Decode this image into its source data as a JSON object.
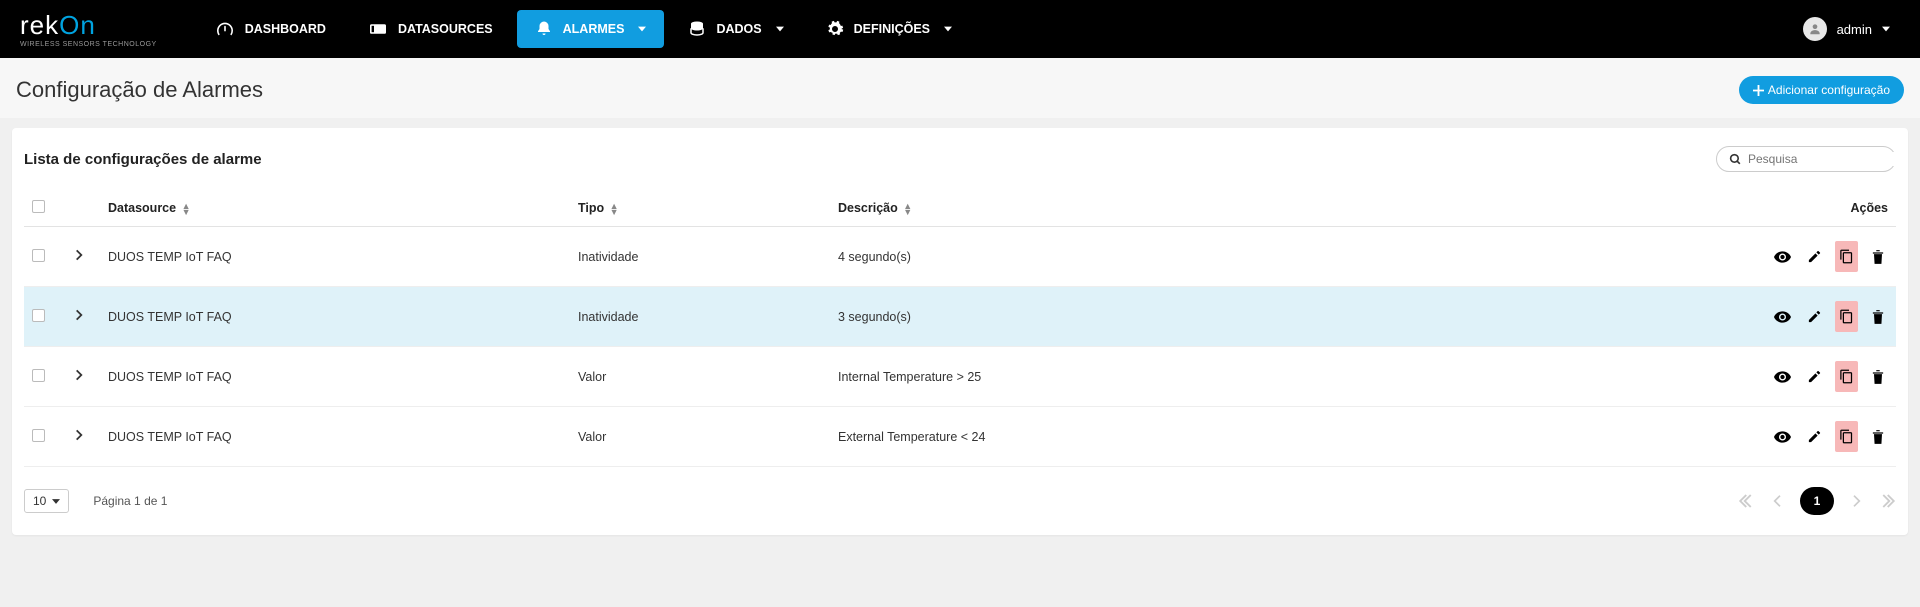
{
  "logo": {
    "part1": "rek",
    "part2": "On",
    "sub": "WIRELESS SENSORS TECHNOLOGY"
  },
  "nav": {
    "dashboard": "DASHBOARD",
    "datasources": "DATASOURCES",
    "alarmes": "ALARMES",
    "dados": "DADOS",
    "definicoes": "DEFINIÇÕES"
  },
  "user": {
    "name": "admin"
  },
  "page": {
    "title": "Configuração de Alarmes",
    "add_btn": "Adicionar configuração"
  },
  "list": {
    "title": "Lista de configurações de alarme",
    "search_placeholder": "Pesquisa",
    "headers": {
      "datasource": "Datasource",
      "tipo": "Tipo",
      "descricao": "Descrição",
      "acoes": "Ações"
    },
    "rows": [
      {
        "datasource": "DUOS TEMP IoT FAQ",
        "tipo": "Inatividade",
        "descricao": "4 segundo(s)",
        "highlight": false
      },
      {
        "datasource": "DUOS TEMP IoT FAQ",
        "tipo": "Inatividade",
        "descricao": "3 segundo(s)",
        "highlight": true
      },
      {
        "datasource": "DUOS TEMP IoT FAQ",
        "tipo": "Valor",
        "descricao": "Internal Temperature > 25",
        "highlight": false
      },
      {
        "datasource": "DUOS TEMP IoT FAQ",
        "tipo": "Valor",
        "descricao": "External Temperature < 24",
        "highlight": false
      }
    ]
  },
  "footer": {
    "page_size": "10",
    "page_info": "Página 1 de 1",
    "current_page": "1"
  }
}
